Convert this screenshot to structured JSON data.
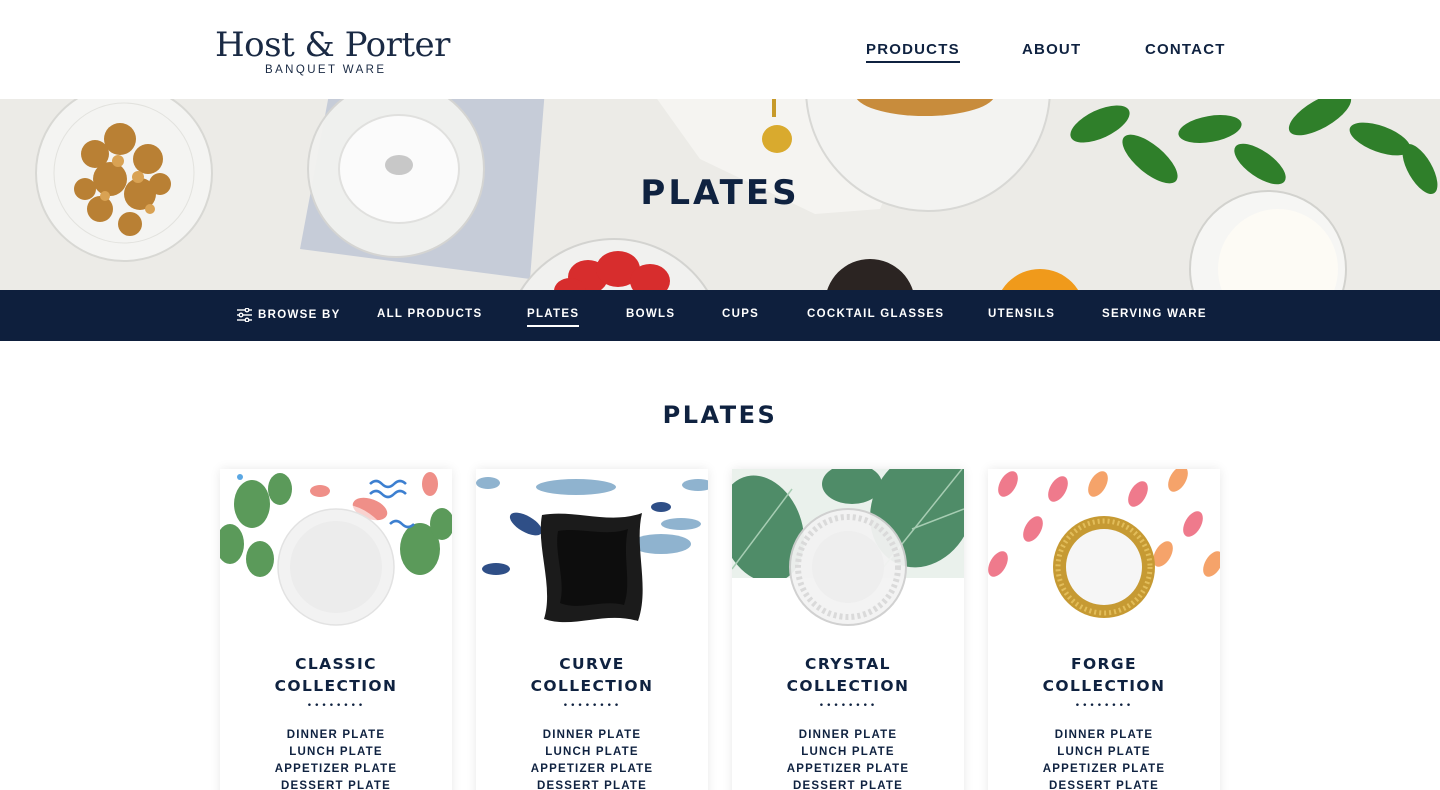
{
  "header": {
    "logo_main": "Host & Porter",
    "logo_sub": "BANQUET WARE",
    "nav": [
      {
        "label": "PRODUCTS",
        "active": true
      },
      {
        "label": "ABOUT",
        "active": false
      },
      {
        "label": "CONTACT",
        "active": false
      }
    ]
  },
  "hero": {
    "title": "PLATES"
  },
  "category_bar": {
    "browse_label": "BROWSE BY",
    "items": [
      {
        "label": "ALL PRODUCTS",
        "active": false
      },
      {
        "label": "PLATES",
        "active": true
      },
      {
        "label": "BOWLS",
        "active": false
      },
      {
        "label": "CUPS",
        "active": false
      },
      {
        "label": "COCKTAIL GLASSES",
        "active": false
      },
      {
        "label": "UTENSILS",
        "active": false
      },
      {
        "label": "SERVING WARE",
        "active": false
      }
    ]
  },
  "section": {
    "title": "PLATES"
  },
  "divider": "••••••••",
  "cards": [
    {
      "name_line1": "CLASSIC",
      "name_line2": "COLLECTION",
      "pattern": "cactus-flamingo",
      "plate": "white-plate",
      "items": [
        "DINNER PLATE",
        "LUNCH PLATE",
        "APPETIZER PLATE",
        "DESSERT PLATE"
      ]
    },
    {
      "name_line1": "CURVE",
      "name_line2": "COLLECTION",
      "pattern": "whales",
      "plate": "black-square-plate",
      "items": [
        "DINNER PLATE",
        "LUNCH PLATE",
        "APPETIZER PLATE",
        "DESSERT PLATE"
      ]
    },
    {
      "name_line1": "CRYSTAL",
      "name_line2": "COLLECTION",
      "pattern": "tropical-leaves",
      "plate": "clear-crystal-plate",
      "items": [
        "DINNER PLATE",
        "LUNCH PLATE",
        "APPETIZER PLATE",
        "DESSERT PLATE"
      ]
    },
    {
      "name_line1": "FORGE",
      "name_line2": "COLLECTION",
      "pattern": "petals",
      "plate": "gold-rim-plate",
      "items": [
        "DINNER PLATE",
        "LUNCH PLATE",
        "APPETIZER PLATE",
        "DESSERT PLATE"
      ]
    }
  ],
  "colors": {
    "navy": "#0e1f3d",
    "text": "#0f2240",
    "white": "#ffffff"
  }
}
